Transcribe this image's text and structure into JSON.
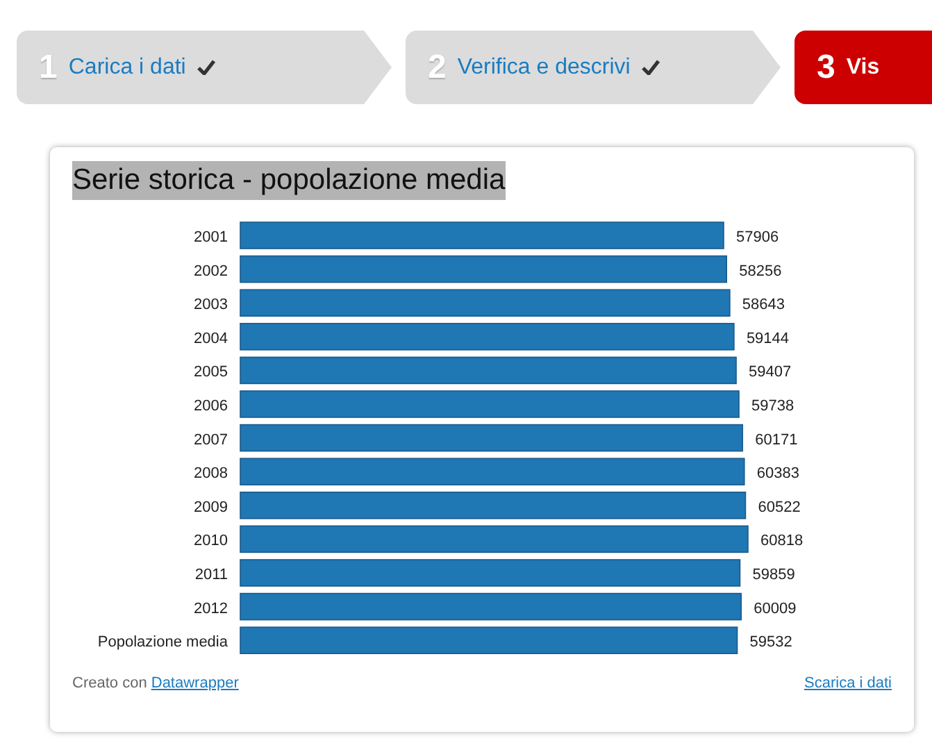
{
  "steps": [
    {
      "number": "1",
      "label": "Carica i dati",
      "done": true,
      "selected": false
    },
    {
      "number": "2",
      "label": "Verifica e descrivi",
      "done": true,
      "selected": false
    },
    {
      "number": "3",
      "label": "Vis",
      "done": false,
      "selected": true
    }
  ],
  "card": {
    "title": "Serie storica - popolazione media",
    "title_highlighted": true,
    "chart_data": {
      "type": "bar",
      "orientation": "horizontal",
      "data_labels": true,
      "categories": [
        "2001",
        "2002",
        "2003",
        "2004",
        "2005",
        "2006",
        "2007",
        "2008",
        "2009",
        "2010",
        "2011",
        "2012",
        "Popolazione media"
      ],
      "values": [
        57906,
        58256,
        58643,
        59144,
        59407,
        59738,
        60171,
        60383,
        60522,
        60818,
        59859,
        60009,
        59532
      ]
    },
    "footer": {
      "credit_text": "Creato con",
      "credit_link": "Datawrapper",
      "download_link": "Scarica i dati"
    }
  }
}
